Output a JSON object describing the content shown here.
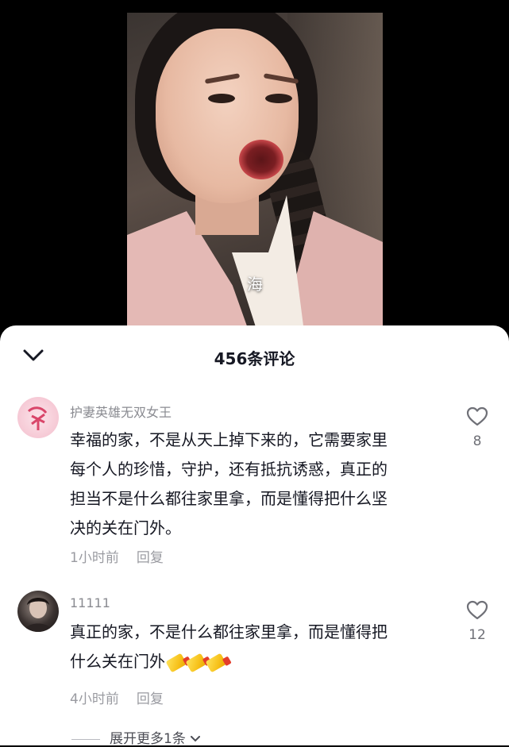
{
  "video": {
    "subtitle": "海"
  },
  "comments_panel": {
    "title": "456条评论",
    "comments": [
      {
        "username": "护妻英雄无双女王",
        "text_lines": [
          "幸福的家，不是从天上掉下来的，它需要家里",
          "每个人的珍惜，守护，还有抵抗诱惑，真正的",
          "担当不是什么都往家里拿，而是懂得把什么坚",
          "决的关在门外。"
        ],
        "time": "1小时前",
        "reply_label": "回复",
        "likes": "8",
        "avatar_icon": "pink-calligraphy-avatar"
      },
      {
        "username": "11111",
        "text_lines": [
          "真正的家，不是什么都往家里拿，而是懂得把",
          "什么关在门外"
        ],
        "emojis": [
          "gold-bar-emoji",
          "gold-bar-emoji",
          "gold-bar-emoji"
        ],
        "time": "4小时前",
        "reply_label": "回复",
        "likes": "12",
        "avatar_icon": "photo-avatar"
      }
    ],
    "expand_more": "展开更多1条"
  },
  "colors": {
    "background": "#000000",
    "sheet": "#ffffff",
    "text_primary": "#161823",
    "text_secondary": "#8a8b91"
  }
}
